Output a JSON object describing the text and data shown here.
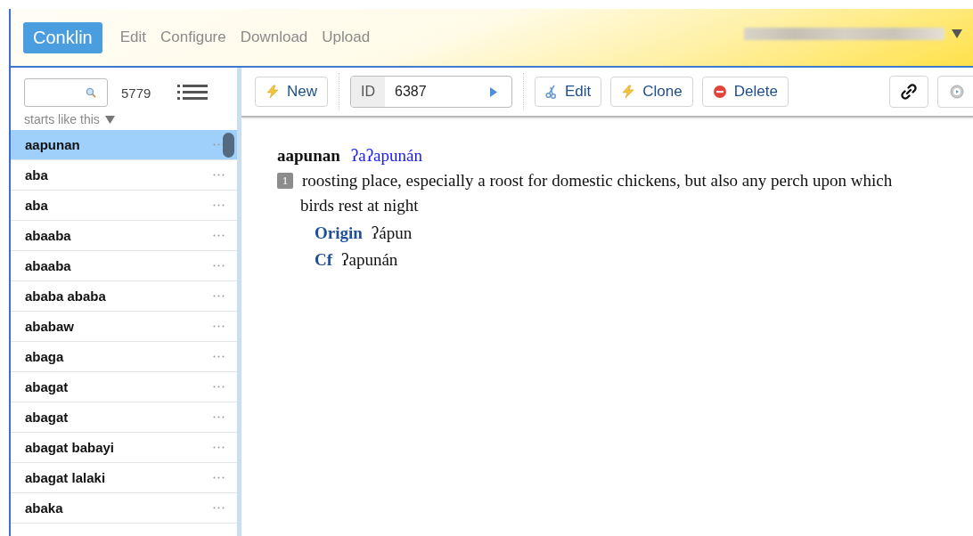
{
  "app": {
    "logo": "Conklin",
    "menu": [
      {
        "label": "Edit"
      },
      {
        "label": "Configure"
      },
      {
        "label": "Download"
      },
      {
        "label": "Upload"
      }
    ]
  },
  "sidebar": {
    "count": "5779",
    "filter": "starts like this",
    "items": [
      {
        "label": "aapunan",
        "selected": true
      },
      {
        "label": "aba",
        "selected": false
      },
      {
        "label": "aba",
        "selected": false
      },
      {
        "label": "abaaba",
        "selected": false
      },
      {
        "label": "abaaba",
        "selected": false
      },
      {
        "label": "ababa ababa",
        "selected": false
      },
      {
        "label": "ababaw",
        "selected": false
      },
      {
        "label": "abaga",
        "selected": false
      },
      {
        "label": "abagat",
        "selected": false
      },
      {
        "label": "abagat",
        "selected": false
      },
      {
        "label": "abagat babayi",
        "selected": false
      },
      {
        "label": "abagat lalaki",
        "selected": false
      },
      {
        "label": "abaka",
        "selected": false
      }
    ]
  },
  "toolbar": {
    "buttons": [
      {
        "kind": "new",
        "label": "New"
      },
      {
        "kind": "id",
        "label": "ID",
        "value": "6387"
      },
      {
        "kind": "edit",
        "label": "Edit"
      },
      {
        "kind": "clone",
        "label": "Clone"
      },
      {
        "kind": "delete",
        "label": "Delete"
      },
      {
        "kind": "link"
      },
      {
        "kind": "history"
      }
    ]
  },
  "entry": {
    "headword": "aapunan",
    "pronunciation": "ʔaʔapunán",
    "senses": [
      {
        "number": "1",
        "definition": "roosting place, especially a roost for domestic chickens, but also any perch upon which birds rest at night"
      }
    ],
    "fields": [
      {
        "label": "Origin",
        "value": "ʔápun"
      },
      {
        "label": "Cf",
        "value": "ʔapunán"
      }
    ]
  }
}
